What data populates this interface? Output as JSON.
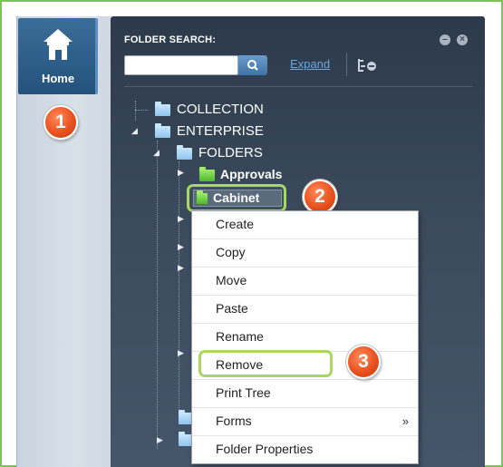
{
  "home": {
    "label": "Home",
    "icon": "home-icon"
  },
  "search": {
    "title": "FOLDER SEARCH:",
    "value": "",
    "expand_label": "Expand",
    "search_icon": "search-icon",
    "tree_icon": "tree-toggle-icon"
  },
  "window_controls": [
    "minimize-icon",
    "close-icon"
  ],
  "tree": {
    "collection": "COLLECTION",
    "enterprise": "ENTERPRISE",
    "folders": "FOLDERS",
    "approvals": "Approvals",
    "cabinet": "Cabinet"
  },
  "context_menu": {
    "items": [
      {
        "label": "Create"
      },
      {
        "label": "Copy"
      },
      {
        "label": "Move"
      },
      {
        "label": "Paste"
      },
      {
        "label": "Rename"
      },
      {
        "label": "Remove"
      },
      {
        "label": "Print Tree"
      },
      {
        "label": "Forms",
        "submenu_arrow": "»"
      },
      {
        "label": "Folder Properties"
      }
    ]
  },
  "step_badges": [
    "1",
    "2",
    "3"
  ],
  "colors": {
    "frame_border": "#7dc35b",
    "panel_dark": "#2c3a4b",
    "highlight_green": "#a8d95e",
    "badge_orange": "#e8521f",
    "folder_blue": "#8ec4ee",
    "folder_green": "#4db82a"
  }
}
